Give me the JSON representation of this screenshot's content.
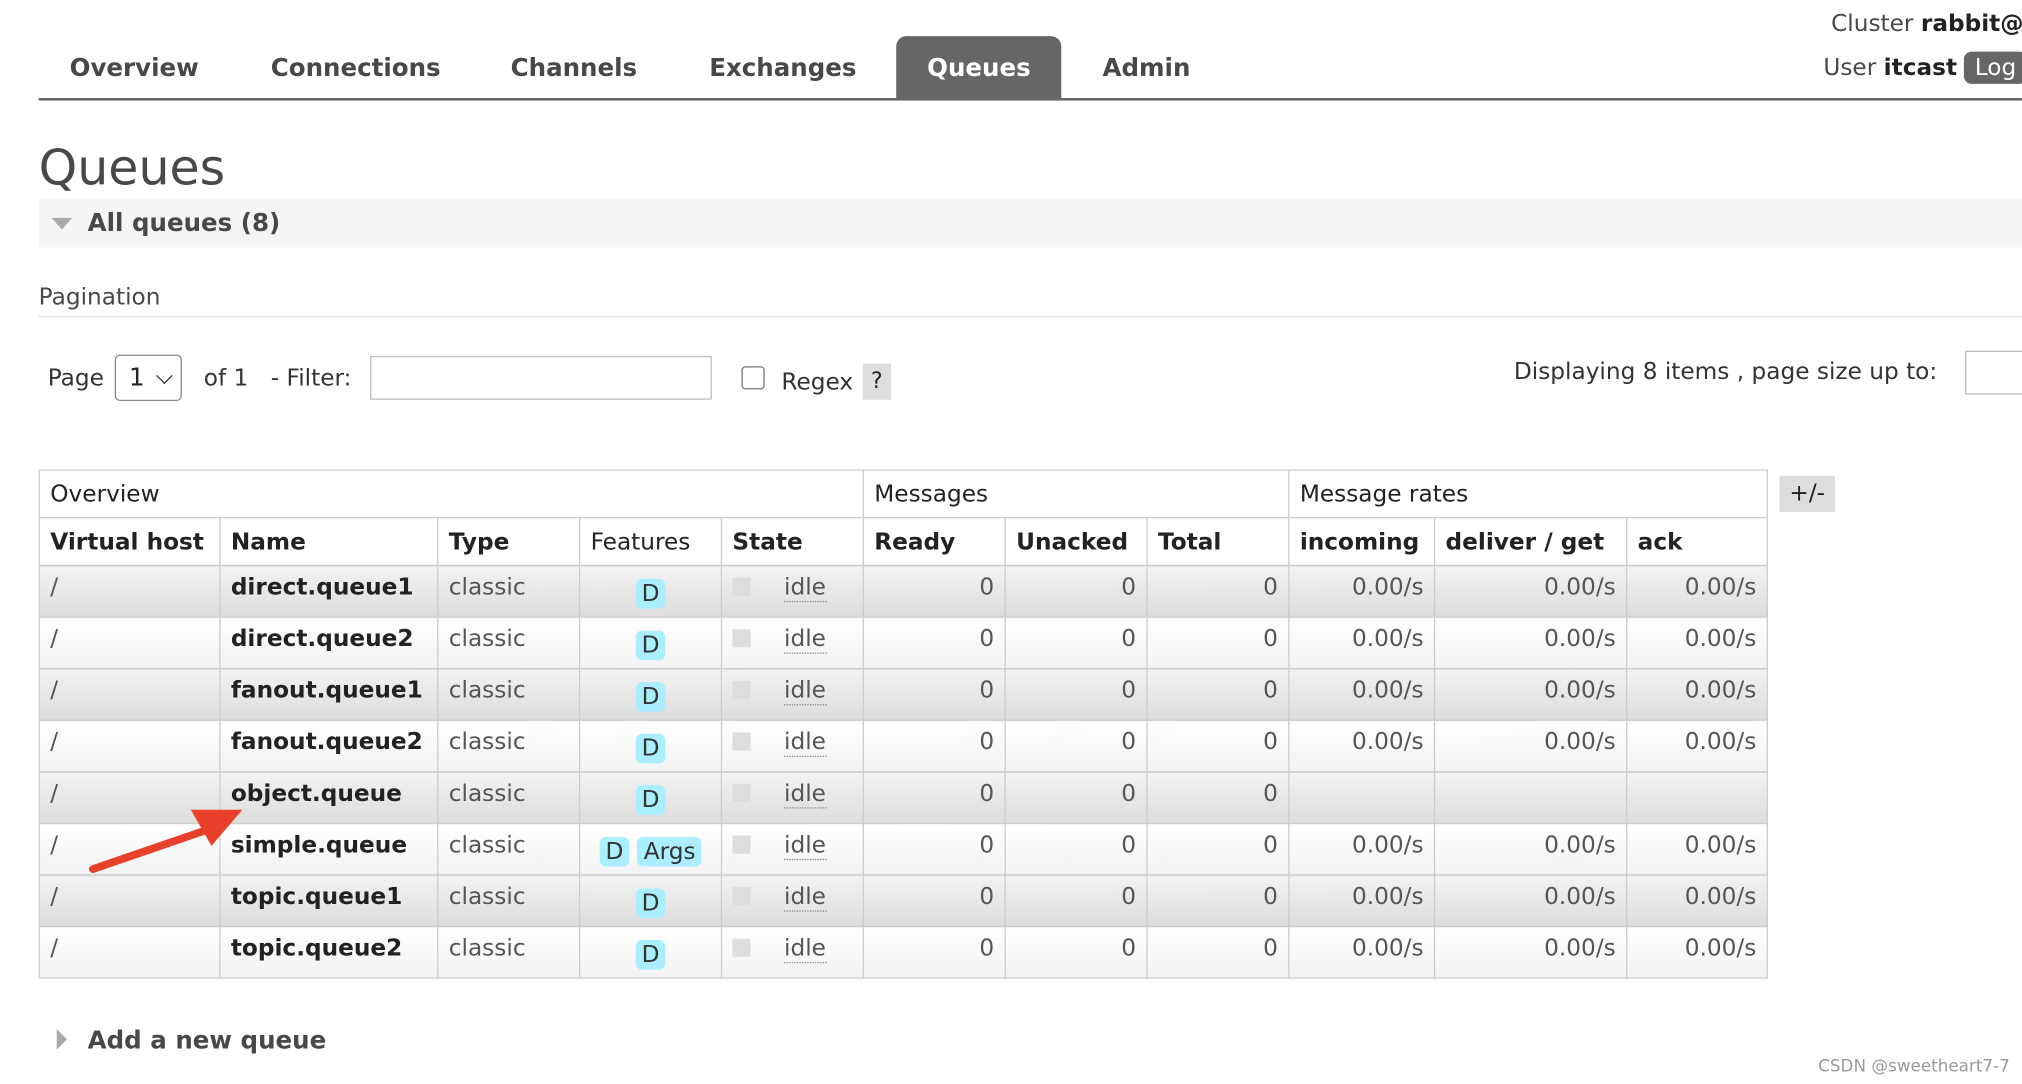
{
  "nav": {
    "tabs": [
      "Overview",
      "Connections",
      "Channels",
      "Exchanges",
      "Queues",
      "Admin"
    ],
    "active": "Queues"
  },
  "header": {
    "cluster_label": "Cluster",
    "cluster_value": "rabbit@",
    "user_label": "User",
    "user_value": "itcast",
    "logout_label": "Log"
  },
  "page_title": "Queues",
  "section_title": "All queues (8)",
  "pagination": {
    "title": "Pagination",
    "page_label": "Page",
    "page_value": "1",
    "of_label": "of 1",
    "filter_label": "- Filter:",
    "filter_value": "",
    "regex_label": "Regex",
    "help_label": "?",
    "displaying": "Displaying 8 items , page size up to:"
  },
  "table": {
    "groups": [
      "Overview",
      "Messages",
      "Message rates"
    ],
    "columns": [
      "Virtual host",
      "Name",
      "Type",
      "Features",
      "State",
      "Ready",
      "Unacked",
      "Total",
      "incoming",
      "deliver / get",
      "ack"
    ],
    "toggle_label": "+/-",
    "rows": [
      {
        "vhost": "/",
        "name": "direct.queue1",
        "type": "classic",
        "features": [
          "D"
        ],
        "state": "idle",
        "ready": "0",
        "unacked": "0",
        "total": "0",
        "incoming": "0.00/s",
        "deliver": "0.00/s",
        "ack": "0.00/s"
      },
      {
        "vhost": "/",
        "name": "direct.queue2",
        "type": "classic",
        "features": [
          "D"
        ],
        "state": "idle",
        "ready": "0",
        "unacked": "0",
        "total": "0",
        "incoming": "0.00/s",
        "deliver": "0.00/s",
        "ack": "0.00/s"
      },
      {
        "vhost": "/",
        "name": "fanout.queue1",
        "type": "classic",
        "features": [
          "D"
        ],
        "state": "idle",
        "ready": "0",
        "unacked": "0",
        "total": "0",
        "incoming": "0.00/s",
        "deliver": "0.00/s",
        "ack": "0.00/s"
      },
      {
        "vhost": "/",
        "name": "fanout.queue2",
        "type": "classic",
        "features": [
          "D"
        ],
        "state": "idle",
        "ready": "0",
        "unacked": "0",
        "total": "0",
        "incoming": "0.00/s",
        "deliver": "0.00/s",
        "ack": "0.00/s"
      },
      {
        "vhost": "/",
        "name": "object.queue",
        "type": "classic",
        "features": [
          "D"
        ],
        "state": "idle",
        "ready": "0",
        "unacked": "0",
        "total": "0",
        "incoming": "",
        "deliver": "",
        "ack": ""
      },
      {
        "vhost": "/",
        "name": "simple.queue",
        "type": "classic",
        "features": [
          "D",
          "Args"
        ],
        "state": "idle",
        "ready": "0",
        "unacked": "0",
        "total": "0",
        "incoming": "0.00/s",
        "deliver": "0.00/s",
        "ack": "0.00/s"
      },
      {
        "vhost": "/",
        "name": "topic.queue1",
        "type": "classic",
        "features": [
          "D"
        ],
        "state": "idle",
        "ready": "0",
        "unacked": "0",
        "total": "0",
        "incoming": "0.00/s",
        "deliver": "0.00/s",
        "ack": "0.00/s"
      },
      {
        "vhost": "/",
        "name": "topic.queue2",
        "type": "classic",
        "features": [
          "D"
        ],
        "state": "idle",
        "ready": "0",
        "unacked": "0",
        "total": "0",
        "incoming": "0.00/s",
        "deliver": "0.00/s",
        "ack": "0.00/s"
      }
    ]
  },
  "add_queue_label": "Add a new queue",
  "watermark": "CSDN @sweetheart7-7",
  "colors": {
    "accent": "#666666",
    "badge": "#aaeeff",
    "arrow": "#e8402a"
  }
}
